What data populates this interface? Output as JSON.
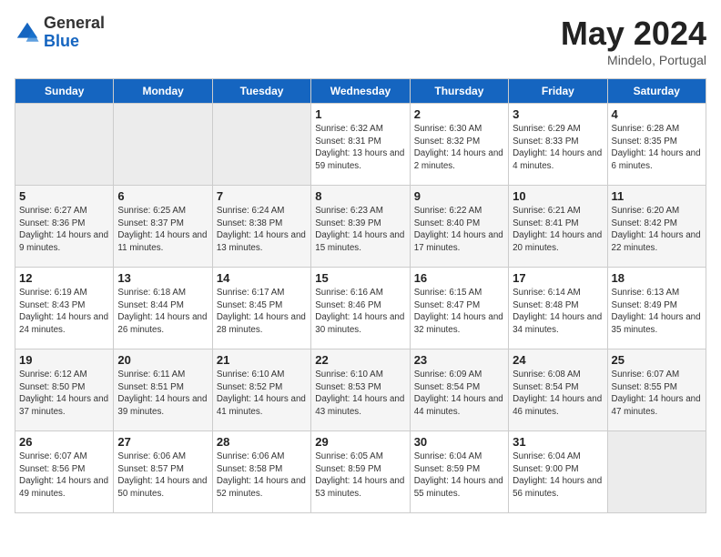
{
  "header": {
    "logo": {
      "general": "General",
      "blue": "Blue"
    },
    "title": "May 2024",
    "location": "Mindelo, Portugal"
  },
  "days_of_week": [
    "Sunday",
    "Monday",
    "Tuesday",
    "Wednesday",
    "Thursday",
    "Friday",
    "Saturday"
  ],
  "weeks": [
    [
      {
        "date": "",
        "info": ""
      },
      {
        "date": "",
        "info": ""
      },
      {
        "date": "",
        "info": ""
      },
      {
        "date": "1",
        "info": "Sunrise: 6:32 AM\nSunset: 8:31 PM\nDaylight: 13 hours and 59 minutes."
      },
      {
        "date": "2",
        "info": "Sunrise: 6:30 AM\nSunset: 8:32 PM\nDaylight: 14 hours and 2 minutes."
      },
      {
        "date": "3",
        "info": "Sunrise: 6:29 AM\nSunset: 8:33 PM\nDaylight: 14 hours and 4 minutes."
      },
      {
        "date": "4",
        "info": "Sunrise: 6:28 AM\nSunset: 8:35 PM\nDaylight: 14 hours and 6 minutes."
      }
    ],
    [
      {
        "date": "5",
        "info": "Sunrise: 6:27 AM\nSunset: 8:36 PM\nDaylight: 14 hours and 9 minutes."
      },
      {
        "date": "6",
        "info": "Sunrise: 6:25 AM\nSunset: 8:37 PM\nDaylight: 14 hours and 11 minutes."
      },
      {
        "date": "7",
        "info": "Sunrise: 6:24 AM\nSunset: 8:38 PM\nDaylight: 14 hours and 13 minutes."
      },
      {
        "date": "8",
        "info": "Sunrise: 6:23 AM\nSunset: 8:39 PM\nDaylight: 14 hours and 15 minutes."
      },
      {
        "date": "9",
        "info": "Sunrise: 6:22 AM\nSunset: 8:40 PM\nDaylight: 14 hours and 17 minutes."
      },
      {
        "date": "10",
        "info": "Sunrise: 6:21 AM\nSunset: 8:41 PM\nDaylight: 14 hours and 20 minutes."
      },
      {
        "date": "11",
        "info": "Sunrise: 6:20 AM\nSunset: 8:42 PM\nDaylight: 14 hours and 22 minutes."
      }
    ],
    [
      {
        "date": "12",
        "info": "Sunrise: 6:19 AM\nSunset: 8:43 PM\nDaylight: 14 hours and 24 minutes."
      },
      {
        "date": "13",
        "info": "Sunrise: 6:18 AM\nSunset: 8:44 PM\nDaylight: 14 hours and 26 minutes."
      },
      {
        "date": "14",
        "info": "Sunrise: 6:17 AM\nSunset: 8:45 PM\nDaylight: 14 hours and 28 minutes."
      },
      {
        "date": "15",
        "info": "Sunrise: 6:16 AM\nSunset: 8:46 PM\nDaylight: 14 hours and 30 minutes."
      },
      {
        "date": "16",
        "info": "Sunrise: 6:15 AM\nSunset: 8:47 PM\nDaylight: 14 hours and 32 minutes."
      },
      {
        "date": "17",
        "info": "Sunrise: 6:14 AM\nSunset: 8:48 PM\nDaylight: 14 hours and 34 minutes."
      },
      {
        "date": "18",
        "info": "Sunrise: 6:13 AM\nSunset: 8:49 PM\nDaylight: 14 hours and 35 minutes."
      }
    ],
    [
      {
        "date": "19",
        "info": "Sunrise: 6:12 AM\nSunset: 8:50 PM\nDaylight: 14 hours and 37 minutes."
      },
      {
        "date": "20",
        "info": "Sunrise: 6:11 AM\nSunset: 8:51 PM\nDaylight: 14 hours and 39 minutes."
      },
      {
        "date": "21",
        "info": "Sunrise: 6:10 AM\nSunset: 8:52 PM\nDaylight: 14 hours and 41 minutes."
      },
      {
        "date": "22",
        "info": "Sunrise: 6:10 AM\nSunset: 8:53 PM\nDaylight: 14 hours and 43 minutes."
      },
      {
        "date": "23",
        "info": "Sunrise: 6:09 AM\nSunset: 8:54 PM\nDaylight: 14 hours and 44 minutes."
      },
      {
        "date": "24",
        "info": "Sunrise: 6:08 AM\nSunset: 8:54 PM\nDaylight: 14 hours and 46 minutes."
      },
      {
        "date": "25",
        "info": "Sunrise: 6:07 AM\nSunset: 8:55 PM\nDaylight: 14 hours and 47 minutes."
      }
    ],
    [
      {
        "date": "26",
        "info": "Sunrise: 6:07 AM\nSunset: 8:56 PM\nDaylight: 14 hours and 49 minutes."
      },
      {
        "date": "27",
        "info": "Sunrise: 6:06 AM\nSunset: 8:57 PM\nDaylight: 14 hours and 50 minutes."
      },
      {
        "date": "28",
        "info": "Sunrise: 6:06 AM\nSunset: 8:58 PM\nDaylight: 14 hours and 52 minutes."
      },
      {
        "date": "29",
        "info": "Sunrise: 6:05 AM\nSunset: 8:59 PM\nDaylight: 14 hours and 53 minutes."
      },
      {
        "date": "30",
        "info": "Sunrise: 6:04 AM\nSunset: 8:59 PM\nDaylight: 14 hours and 55 minutes."
      },
      {
        "date": "31",
        "info": "Sunrise: 6:04 AM\nSunset: 9:00 PM\nDaylight: 14 hours and 56 minutes."
      },
      {
        "date": "",
        "info": ""
      }
    ]
  ]
}
